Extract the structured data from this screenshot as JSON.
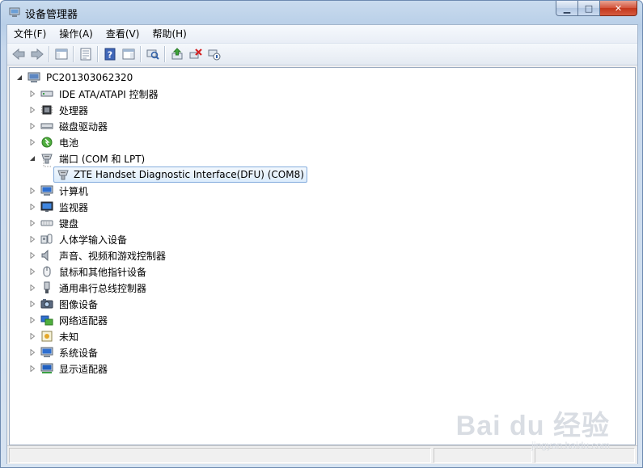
{
  "window": {
    "title": "设备管理器",
    "controls": {
      "minimize": "▁",
      "maximize": "□",
      "close": "✕"
    }
  },
  "menu": [
    {
      "label": "文件(F)"
    },
    {
      "label": "操作(A)"
    },
    {
      "label": "查看(V)"
    },
    {
      "label": "帮助(H)"
    }
  ],
  "toolbar": {
    "icons": [
      "back-arrow-icon",
      "forward-arrow-icon",
      "show-hide-console-tree-icon",
      "properties-icon",
      "help-icon",
      "action-pane-icon",
      "scan-hardware-icon",
      "update-driver-icon",
      "uninstall-icon",
      "disable-device-icon"
    ]
  },
  "tree": {
    "root": {
      "label": "PC201303062320",
      "icon": "computer-icon"
    },
    "nodes": [
      {
        "label": "IDE ATA/ATAPI 控制器",
        "icon": "ide-controller-icon",
        "expanded": false
      },
      {
        "label": "处理器",
        "icon": "processor-icon",
        "expanded": false
      },
      {
        "label": "磁盘驱动器",
        "icon": "disk-drive-icon",
        "expanded": false
      },
      {
        "label": "电池",
        "icon": "battery-icon",
        "expanded": false
      },
      {
        "label": "端口 (COM 和 LPT)",
        "icon": "port-icon",
        "expanded": true,
        "children": [
          {
            "label": "ZTE Handset Diagnostic Interface(DFU) (COM8)",
            "icon": "port-icon",
            "selected": true
          }
        ]
      },
      {
        "label": "计算机",
        "icon": "computer-icon",
        "expanded": false
      },
      {
        "label": "监视器",
        "icon": "monitor-icon",
        "expanded": false
      },
      {
        "label": "键盘",
        "icon": "keyboard-icon",
        "expanded": false
      },
      {
        "label": "人体学输入设备",
        "icon": "hid-icon",
        "expanded": false
      },
      {
        "label": "声音、视频和游戏控制器",
        "icon": "speaker-icon",
        "expanded": false
      },
      {
        "label": "鼠标和其他指针设备",
        "icon": "mouse-icon",
        "expanded": false
      },
      {
        "label": "通用串行总线控制器",
        "icon": "usb-icon",
        "expanded": false
      },
      {
        "label": "图像设备",
        "icon": "camera-icon",
        "expanded": false
      },
      {
        "label": "网络适配器",
        "icon": "network-icon",
        "expanded": false
      },
      {
        "label": "未知",
        "icon": "unknown-device-icon",
        "expanded": false
      },
      {
        "label": "系统设备",
        "icon": "system-device-icon",
        "expanded": false
      },
      {
        "label": "显示适配器",
        "icon": "display-adapter-icon",
        "expanded": false
      }
    ]
  },
  "watermark": {
    "main": "Bai du 经验",
    "sub": "jingyan.baidu.com"
  }
}
